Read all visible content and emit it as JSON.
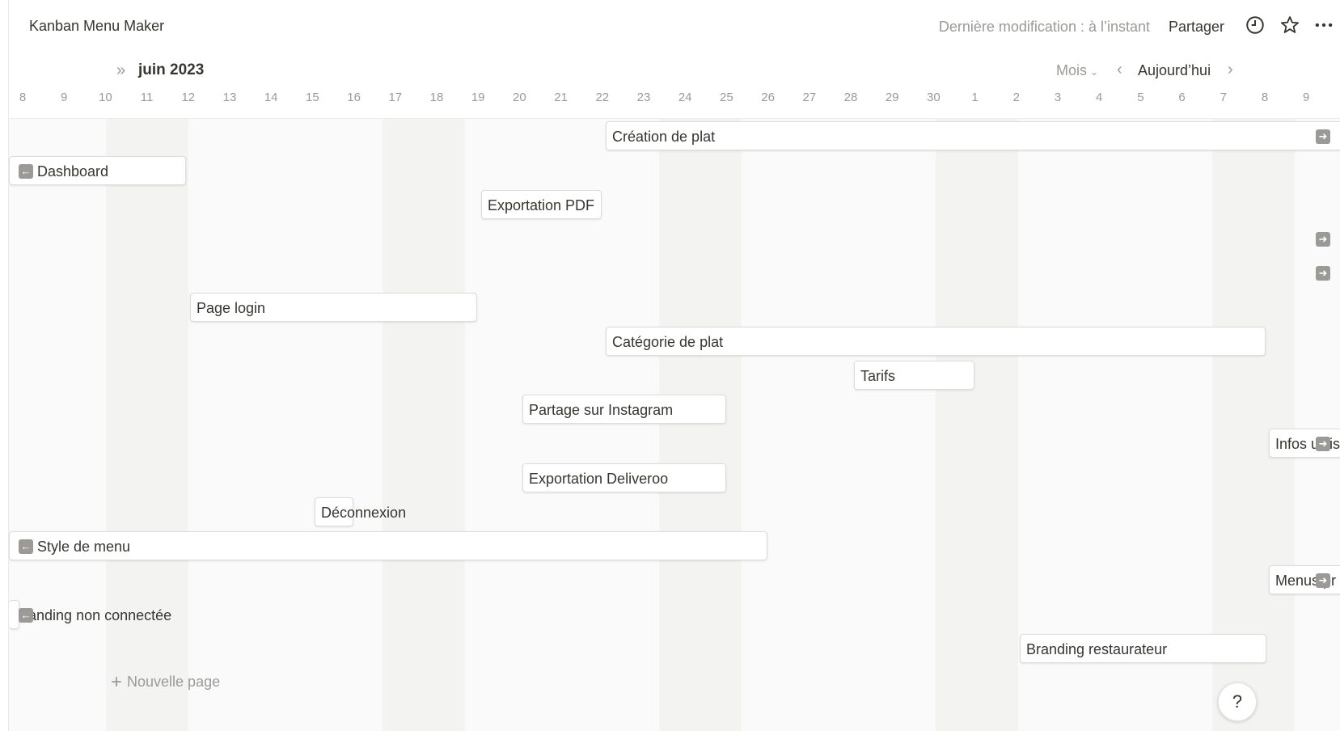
{
  "topbar": {
    "title": "Kanban Menu Maker",
    "last_edit": "Dernière modification : à l’instant",
    "share_label": "Partager",
    "icons": [
      "clock-icon",
      "star-icon",
      "more-icon"
    ]
  },
  "timeline": {
    "month": "juin 2023",
    "view_mode": "Mois",
    "today_label": "Aujourd’hui",
    "days": [
      "8",
      "9",
      "10",
      "11",
      "12",
      "13",
      "14",
      "15",
      "16",
      "17",
      "18",
      "19",
      "20",
      "21",
      "22",
      "23",
      "24",
      "25",
      "26",
      "27",
      "28",
      "29",
      "30",
      "1",
      "2",
      "3",
      "4",
      "5",
      "6",
      "7",
      "8",
      "9"
    ]
  },
  "tasks": [
    {
      "label": "Création de plat"
    },
    {
      "label": "Dashboard"
    },
    {
      "label": "Exportation PDF"
    },
    {
      "label": "Page login"
    },
    {
      "label": "Catégorie de plat"
    },
    {
      "label": "Tarifs"
    },
    {
      "label": "Partage sur Instagram"
    },
    {
      "label": "Infos utilis"
    },
    {
      "label": "Exportation Deliveroo"
    },
    {
      "label": "Déconnexion"
    },
    {
      "label": "Style de menu"
    },
    {
      "label": "Menus pr"
    },
    {
      "label": "Landing non connectée"
    },
    {
      "label": "Branding restaurateur"
    }
  ],
  "new_page_label": "Nouvelle page",
  "help_label": "?",
  "colors": {
    "text": "#37352f",
    "muted": "#9b9a97",
    "weekend": "#f3f3f2",
    "background": "#fafafa"
  }
}
